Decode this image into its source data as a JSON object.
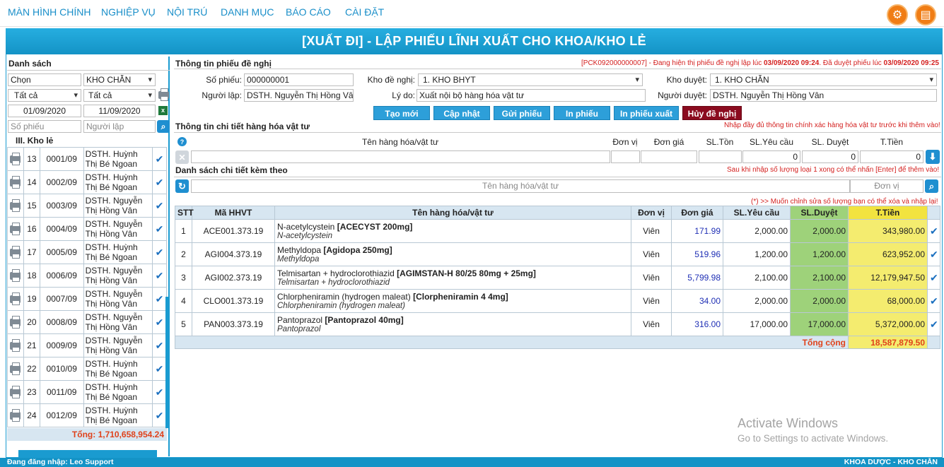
{
  "topnav": {
    "items": [
      "MÀN HÌNH CHÍNH",
      "NGHIỆP VỤ",
      "NỘI TRÚ",
      "DANH MỤC",
      "BÁO CÁO",
      "CÀI ĐẶT"
    ]
  },
  "page_title": "[XUẤT ĐI] - LẬP PHIẾU LĨNH XUẤT CHO KHOA/KHO LẺ",
  "left": {
    "header": "Danh sách",
    "filter": {
      "chon": "Chọn",
      "kho": "KHO CHẴN",
      "tatca1": "Tất cả",
      "tatca2": "Tất cả",
      "from_date": "01/09/2020",
      "to_date": "11/09/2020",
      "so_phieu_ph": "Số phiếu",
      "nguoi_lap_ph": "Người lập"
    },
    "group": "III. Kho lẻ",
    "rows": [
      {
        "no": "13",
        "code": "0001/09",
        "name1": "DSTH. Huỳnh",
        "name2": "Thị Bé Ngoan"
      },
      {
        "no": "14",
        "code": "0002/09",
        "name1": "DSTH. Huỳnh",
        "name2": "Thị Bé Ngoan"
      },
      {
        "no": "15",
        "code": "0003/09",
        "name1": "DSTH. Nguyễn",
        "name2": "Thị Hồng Vân"
      },
      {
        "no": "16",
        "code": "0004/09",
        "name1": "DSTH. Nguyễn",
        "name2": "Thị Hồng Vân"
      },
      {
        "no": "17",
        "code": "0005/09",
        "name1": "DSTH. Huỳnh",
        "name2": "Thị Bé Ngoan"
      },
      {
        "no": "18",
        "code": "0006/09",
        "name1": "DSTH. Nguyễn",
        "name2": "Thị Hồng Vân"
      },
      {
        "no": "19",
        "code": "0007/09",
        "name1": "DSTH. Nguyễn",
        "name2": "Thị Hồng Vân"
      },
      {
        "no": "20",
        "code": "0008/09",
        "name1": "DSTH. Nguyễn",
        "name2": "Thị Hồng Vân"
      },
      {
        "no": "21",
        "code": "0009/09",
        "name1": "DSTH. Nguyễn",
        "name2": "Thị Hồng Vân"
      },
      {
        "no": "22",
        "code": "0010/09",
        "name1": "DSTH. Huỳnh",
        "name2": "Thị Bé Ngoan"
      },
      {
        "no": "23",
        "code": "0011/09",
        "name1": "DSTH. Huỳnh",
        "name2": "Thị Bé Ngoan"
      },
      {
        "no": "24",
        "code": "0012/09",
        "name1": "DSTH. Huỳnh",
        "name2": "Thị Bé Ngoan"
      }
    ],
    "total": "Tổng: 1,710,658,954.24"
  },
  "info": {
    "header": "Thông tin phiếu đề nghị",
    "status_prefix": "[PCK092000000007] - Đang hiện thị phiếu đề nghị lập lúc ",
    "status_created": "03/09/2020 09:24",
    "status_mid": ". Đã duyệt phiếu lúc ",
    "status_approved": "03/09/2020 09:25",
    "so_phieu_label": "Số phiếu:",
    "so_phieu": "000000001",
    "kho_de_nghi_label": "Kho đề nghị:",
    "kho_de_nghi": "1. KHO BHYT",
    "kho_duyet_label": "Kho duyệt:",
    "kho_duyet": "1. KHO CHẴN",
    "nguoi_lap_label": "Người lập:",
    "nguoi_lap": "DSTH. Nguyễn Thị Hồng Vân",
    "ly_do_label": "Lý do:",
    "ly_do": "Xuất nội bộ hàng hóa vật tư",
    "nguoi_duyet_label": "Người duyệt:",
    "nguoi_duyet": "DSTH. Nguyễn Thị Hồng Vân"
  },
  "actions": [
    "Tạo mới",
    "Cập nhật",
    "Gửi phiếu",
    "In phiếu",
    "In phiếu xuất",
    "Hủy đề nghị"
  ],
  "detail": {
    "header": "Thông tin chi tiết hàng hóa vật tư",
    "note": "Nhập đầy đủ thông tin chính xác hàng hóa vật tư trước khi thêm vào!",
    "cols": [
      "Tên hàng hóa/vật tư",
      "Đơn vị",
      "Đơn giá",
      "SL.Tồn",
      "SL.Yêu cầu",
      "SL. Duyệt",
      "T.Tiền"
    ],
    "yc": "0",
    "duyet": "0",
    "tien": "0"
  },
  "list": {
    "header": "Danh sách chi tiết kèm theo",
    "note": "Sau khi nhập số lượng loại 1 xong có thể nhấn [Enter] để thêm vào!",
    "search_ph": "Tên hàng hóa/vật tư",
    "unit_ph": "Đơn vị",
    "edit_note": "(*) >> Muốn chỉnh sửa số lượng bạn có thể xóa và nhập lại!"
  },
  "table": {
    "headers": [
      "STT",
      "Mã HHVT",
      "Tên hàng hóa/vật tư",
      "Đơn vị",
      "Đơn giá",
      "SL.Yêu cầu",
      "SL.Duyệt",
      "T.Tiền"
    ],
    "rows": [
      {
        "stt": "1",
        "code": "ACE001.373.19",
        "name": "N-acetylcystein ",
        "brand": "[ACECYST 200mg]",
        "generic": "N-acetylcystein",
        "unit": "Viên",
        "price": "171.99",
        "req": "2,000.00",
        "appr": "2,000.00",
        "total": "343,980.00"
      },
      {
        "stt": "2",
        "code": "AGI004.373.19",
        "name": "Methyldopa ",
        "brand": "[Agidopa 250mg]",
        "generic": "Methyldopa",
        "unit": "Viên",
        "price": "519.96",
        "req": "1,200.00",
        "appr": "1,200.00",
        "total": "623,952.00"
      },
      {
        "stt": "3",
        "code": "AGI002.373.19",
        "name": "Telmisartan + hydroclorothiazid ",
        "brand": "[AGIMSTAN-H 80/25 80mg + 25mg]",
        "generic": "Telmisartan + hydroclorothiazid",
        "unit": "Viên",
        "price": "5,799.98",
        "req": "2,100.00",
        "appr": "2,100.00",
        "total": "12,179,947.50"
      },
      {
        "stt": "4",
        "code": "CLO001.373.19",
        "name": "Chlorpheniramin (hydrogen maleat) ",
        "brand": "[Clorpheniramin 4 4mg]",
        "generic": "Chlorpheniramin (hydrogen maleat)",
        "unit": "Viên",
        "price": "34.00",
        "req": "2,000.00",
        "appr": "2,000.00",
        "total": "68,000.00"
      },
      {
        "stt": "5",
        "code": "PAN003.373.19",
        "name": "Pantoprazol ",
        "brand": "[Pantoprazol 40mg]",
        "generic": "Pantoprazol",
        "unit": "Viên",
        "price": "316.00",
        "req": "17,000.00",
        "appr": "17,000.00",
        "total": "5,372,000.00"
      }
    ],
    "total_label": "Tổng cộng",
    "total_value": "18,587,879.50"
  },
  "watermark": {
    "line1": "Activate Windows",
    "line2": "Go to Settings to activate Windows."
  },
  "status": {
    "left": "Đang đăng nhập: Leo Support",
    "right": "KHOA DƯỢC - KHO CHẴN"
  }
}
